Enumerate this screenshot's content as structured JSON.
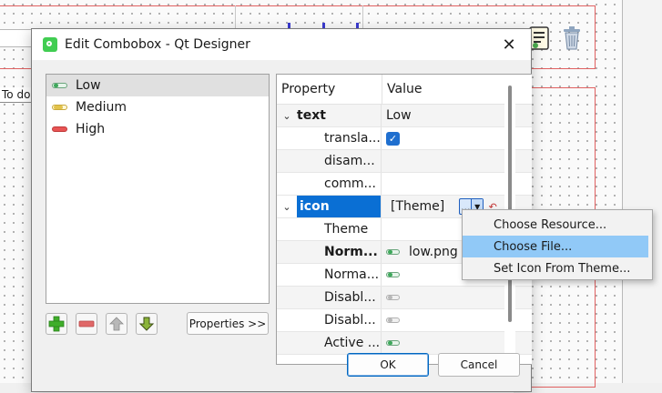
{
  "background": {
    "label_todo": "To do"
  },
  "dialog": {
    "title": "Edit Combobox - Qt Designer",
    "close_glyph": "✕",
    "items": [
      {
        "label": "Low",
        "icon": "low-priority-icon",
        "selected": true
      },
      {
        "label": "Medium",
        "icon": "medium-priority-icon",
        "selected": false
      },
      {
        "label": "High",
        "icon": "high-priority-icon",
        "selected": false
      }
    ],
    "properties_button": "Properties >>",
    "ok": "OK",
    "cancel": "Cancel"
  },
  "property_editor": {
    "header_property": "Property",
    "header_value": "Value",
    "rows": {
      "text": {
        "name": "text",
        "value": "Low"
      },
      "translatable": {
        "name": "transla..."
      },
      "disambiguation": {
        "name": "disam..."
      },
      "comment": {
        "name": "comm..."
      },
      "icon": {
        "name": "icon",
        "value": "[Theme]",
        "dots": "...",
        "arrow": "▼",
        "reset": "↶"
      },
      "theme": {
        "name": "Theme"
      },
      "normal_off": {
        "name": "Norm...",
        "value": "low.png"
      },
      "normal_on": {
        "name": "Norma..."
      },
      "disabled_off": {
        "name": "Disabl..."
      },
      "disabled_on": {
        "name": "Disabl..."
      },
      "active_off": {
        "name": "Active ..."
      }
    }
  },
  "context_menu": {
    "items": [
      "Choose Resource...",
      "Choose File...",
      "Set Icon From Theme..."
    ],
    "highlighted": "Choose File..."
  },
  "colors": {
    "selection_blue": "#0a6fd4",
    "menu_hover": "#91c9f7",
    "guide_red": "#e06060"
  }
}
